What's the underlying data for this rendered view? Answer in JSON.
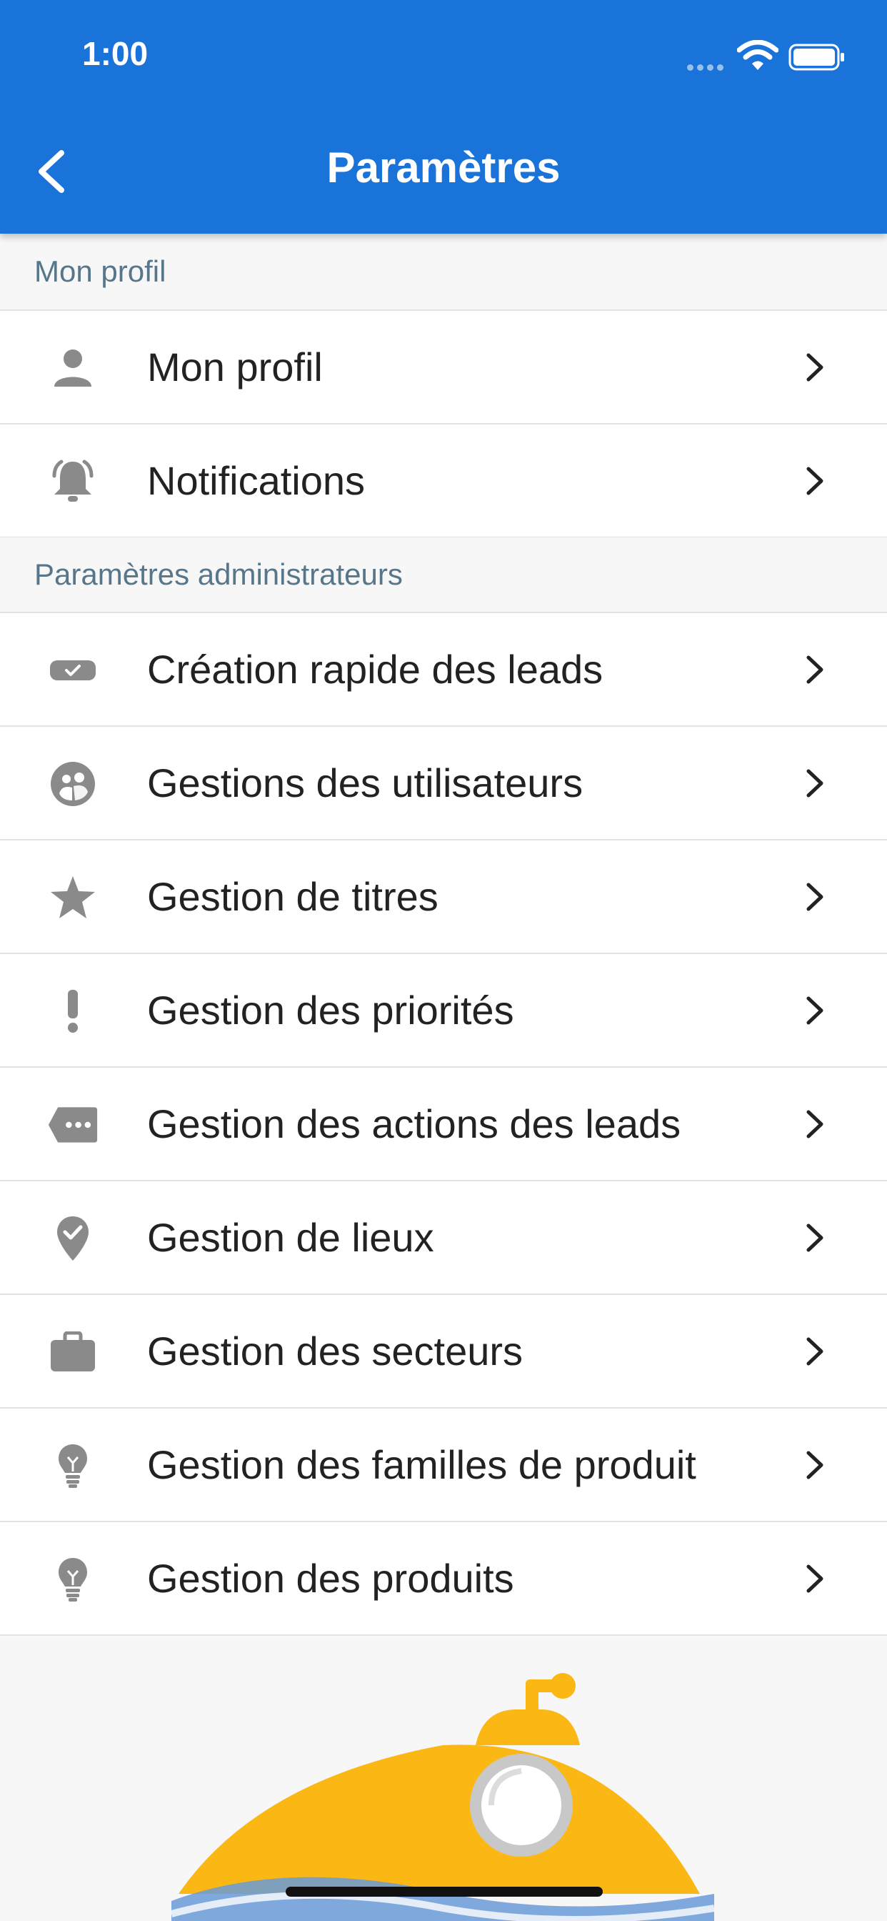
{
  "status_bar": {
    "time": "1:00"
  },
  "header": {
    "title": "Paramètres"
  },
  "sections": [
    {
      "title": "Mon profil",
      "items": [
        {
          "label": "Mon profil",
          "icon": "person-icon"
        },
        {
          "label": "Notifications",
          "icon": "bell-icon"
        }
      ]
    },
    {
      "title": "Paramètres administrateurs",
      "items": [
        {
          "label": "Création rapide des leads",
          "icon": "ticket-check-icon"
        },
        {
          "label": "Gestions des utilisateurs",
          "icon": "users-circle-icon"
        },
        {
          "label": "Gestion de titres",
          "icon": "star-icon"
        },
        {
          "label": "Gestion des priorités",
          "icon": "exclamation-icon"
        },
        {
          "label": "Gestion des actions des leads",
          "icon": "tag-dots-icon"
        },
        {
          "label": "Gestion de lieux",
          "icon": "location-check-icon"
        },
        {
          "label": "Gestion des secteurs",
          "icon": "briefcase-icon"
        },
        {
          "label": "Gestion des familles de produit",
          "icon": "lightbulb-icon"
        },
        {
          "label": "Gestion des produits",
          "icon": "lightbulb-icon"
        }
      ]
    }
  ],
  "colors": {
    "appbar": "#1a73d9",
    "section_text": "#58768a",
    "icon": "#8a8a8a",
    "mascot_yellow": "#fbb814",
    "mascot_wave": "#6a9ad8"
  }
}
